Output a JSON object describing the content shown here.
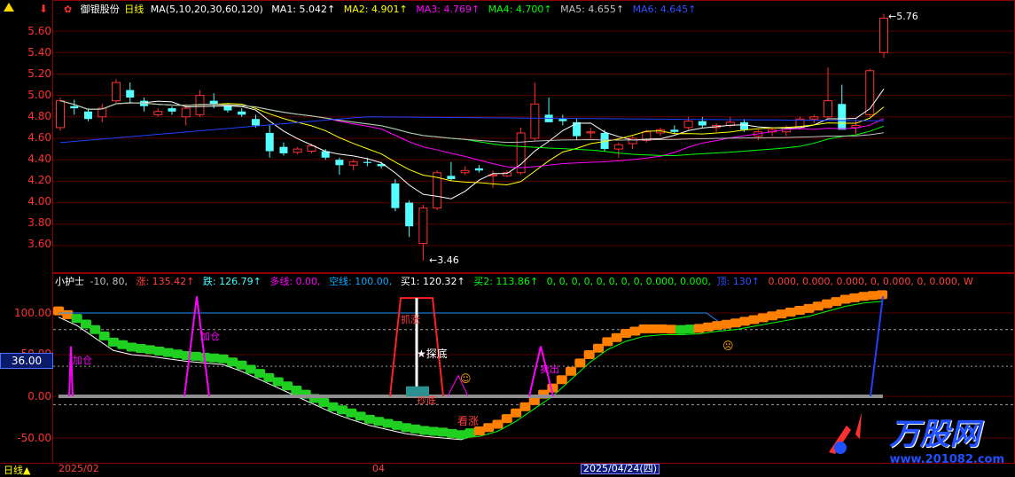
{
  "stock": {
    "name": "御银股份",
    "period": "日线"
  },
  "ma_header": {
    "formula": "MA(5,10,20,30,60,120)",
    "items": [
      {
        "label": "MA1:",
        "value": "5.042↑",
        "color": "#ffffff"
      },
      {
        "label": "MA2:",
        "value": "4.901↑",
        "color": "#ffff00"
      },
      {
        "label": "MA3:",
        "value": "4.769↑",
        "color": "#ff00ff"
      },
      {
        "label": "MA4:",
        "value": "4.700↑",
        "color": "#00ff00"
      },
      {
        "label": "MA5:",
        "value": "4.655↑",
        "color": "#c0c0c0"
      },
      {
        "label": "MA6:",
        "value": "4.645↑",
        "color": "#3050ff"
      }
    ]
  },
  "price_axis": [
    "5.60",
    "5.40",
    "5.20",
    "5.00",
    "4.80",
    "4.60",
    "4.40",
    "4.20",
    "4.00",
    "3.80",
    "3.60"
  ],
  "price_annotations": {
    "high": "5.76",
    "low": "3.46"
  },
  "indicator_header": {
    "name": "小护士",
    "params": "-10, 80,",
    "items": [
      {
        "label": "涨:",
        "value": "135.42↑",
        "color": "#ff4040"
      },
      {
        "label": "跌:",
        "value": "126.79↑",
        "color": "#40ffff"
      },
      {
        "label": "多线:",
        "value": "0.00,",
        "color": "#ff00ff"
      },
      {
        "label": "空线:",
        "value": "100.00,",
        "color": "#00aaff"
      },
      {
        "label": "买1:",
        "value": "120.32↑",
        "color": "#ffffff"
      },
      {
        "label": "买2:",
        "value": "113.86↑",
        "color": "#00ff00"
      },
      {
        "label": "",
        "value": "0, 0, 0, 0, 0, 0, 0, 0, 0.000, 0.000,",
        "color": "#ff4040"
      },
      {
        "label": "顶:",
        "value": "130↑",
        "color": "#3050ff"
      },
      {
        "label": "",
        "value": "0.000, 0.000, 0.000, 0, 0.000, 0, 0.000, W",
        "color": "#ff4040"
      }
    ]
  },
  "indicator_axis": [
    "100.00",
    "50.00",
    "0.00",
    "-50.00"
  ],
  "highlight_value": "36.00",
  "indicator_labels": {
    "jiacang1": "加仓",
    "jiacang2": "加仓",
    "zhuaniu": "抓涨",
    "tandi": "探底",
    "chaodi": "抄底",
    "kanzhang": "看涨",
    "maichu": "卖出"
  },
  "bottom": {
    "period_label": "日线▲",
    "date1": "2025/02",
    "date2": "04",
    "date_highlight": "2025/04/24(四)"
  },
  "watermark": {
    "brand": "万股网",
    "url": "www.201082.com"
  },
  "chart_data": [
    {
      "type": "candlestick",
      "title": "御银股份 日线",
      "ylim": [
        3.5,
        5.8
      ],
      "note": "approximate daily OHLC read from chart",
      "series": [
        {
          "name": "K",
          "values": [
            [
              4.7,
              4.98,
              4.67,
              4.95
            ],
            [
              4.9,
              4.96,
              4.82,
              4.88
            ],
            [
              4.85,
              4.88,
              4.76,
              4.78
            ],
            [
              4.8,
              4.92,
              4.75,
              4.88
            ],
            [
              4.95,
              5.15,
              4.93,
              5.12
            ],
            [
              5.05,
              5.12,
              4.93,
              4.98
            ],
            [
              4.95,
              4.98,
              4.85,
              4.9
            ],
            [
              4.82,
              4.88,
              4.8,
              4.85
            ],
            [
              4.88,
              4.9,
              4.82,
              4.85
            ],
            [
              4.8,
              4.92,
              4.72,
              4.88
            ],
            [
              4.82,
              5.05,
              4.8,
              5.0
            ],
            [
              4.95,
              5.02,
              4.88,
              4.92
            ],
            [
              4.9,
              4.92,
              4.84,
              4.86
            ],
            [
              4.85,
              4.88,
              4.8,
              4.82
            ],
            [
              4.78,
              4.82,
              4.7,
              4.72
            ],
            [
              4.65,
              4.72,
              4.42,
              4.48
            ],
            [
              4.52,
              4.56,
              4.44,
              4.46
            ],
            [
              4.47,
              4.52,
              4.45,
              4.5
            ],
            [
              4.48,
              4.55,
              4.46,
              4.53
            ],
            [
              4.48,
              4.5,
              4.4,
              4.42
            ],
            [
              4.4,
              4.42,
              4.26,
              4.35
            ],
            [
              4.35,
              4.4,
              4.3,
              4.38
            ],
            [
              4.38,
              4.42,
              4.34,
              4.37
            ],
            [
              4.36,
              4.38,
              4.32,
              4.34
            ],
            [
              4.18,
              4.22,
              3.92,
              3.95
            ],
            [
              4.0,
              4.02,
              3.68,
              3.78
            ],
            [
              3.62,
              3.98,
              3.46,
              3.95
            ],
            [
              3.95,
              4.3,
              3.93,
              4.28
            ],
            [
              4.25,
              4.38,
              4.2,
              4.22
            ],
            [
              4.28,
              4.34,
              4.26,
              4.3
            ],
            [
              4.32,
              4.35,
              4.28,
              4.3
            ],
            [
              4.25,
              4.3,
              4.14,
              4.26
            ],
            [
              4.25,
              4.3,
              4.24,
              4.28
            ],
            [
              4.28,
              4.7,
              4.26,
              4.65
            ],
            [
              4.6,
              5.12,
              4.58,
              4.92
            ],
            [
              4.82,
              4.98,
              4.76,
              4.75
            ],
            [
              4.78,
              4.82,
              4.72,
              4.76
            ],
            [
              4.75,
              4.78,
              4.58,
              4.62
            ],
            [
              4.65,
              4.7,
              4.6,
              4.66
            ],
            [
              4.65,
              4.68,
              4.48,
              4.5
            ],
            [
              4.5,
              4.56,
              4.42,
              4.54
            ],
            [
              4.55,
              4.62,
              4.5,
              4.6
            ],
            [
              4.58,
              4.68,
              4.56,
              4.66
            ],
            [
              4.65,
              4.7,
              4.62,
              4.68
            ],
            [
              4.68,
              4.72,
              4.64,
              4.66
            ],
            [
              4.7,
              4.8,
              4.68,
              4.76
            ],
            [
              4.76,
              4.8,
              4.7,
              4.72
            ],
            [
              4.7,
              4.74,
              4.66,
              4.72
            ],
            [
              4.72,
              4.8,
              4.7,
              4.75
            ],
            [
              4.75,
              4.78,
              4.66,
              4.68
            ],
            [
              4.62,
              4.68,
              4.58,
              4.66
            ],
            [
              4.66,
              4.7,
              4.62,
              4.68
            ],
            [
              4.66,
              4.72,
              4.62,
              4.7
            ],
            [
              4.7,
              4.8,
              4.68,
              4.78
            ],
            [
              4.78,
              4.82,
              4.74,
              4.8
            ],
            [
              4.8,
              5.26,
              4.78,
              4.95
            ],
            [
              4.92,
              5.1,
              4.7,
              4.68
            ],
            [
              4.7,
              4.78,
              4.64,
              4.72
            ],
            [
              4.82,
              5.25,
              4.8,
              5.23
            ],
            [
              5.4,
              5.76,
              5.35,
              5.72
            ]
          ]
        }
      ]
    },
    {
      "type": "line",
      "title": "小护士",
      "ylim": [
        -60,
        150
      ],
      "series": [
        {
          "name": "买1",
          "values": [
            95,
            85,
            70,
            55,
            50,
            48,
            45,
            42,
            40,
            38,
            30,
            20,
            10,
            0,
            -10,
            -20,
            -28,
            -35,
            -40,
            -45,
            -48,
            -50,
            -52,
            -45,
            -35,
            -20,
            -5,
            10,
            30,
            50,
            65,
            75,
            80,
            78,
            76,
            78,
            82,
            86,
            90,
            95,
            100,
            105,
            110,
            115,
            118,
            120
          ]
        },
        {
          "name": "买2",
          "values": [
            100,
            92,
            80,
            65,
            58,
            54,
            50,
            46,
            44,
            42,
            35,
            25,
            15,
            5,
            -5,
            -15,
            -22,
            -30,
            -35,
            -40,
            -44,
            -46,
            -50,
            -48,
            -42,
            -30,
            -15,
            0,
            20,
            40,
            56,
            66,
            72,
            74,
            74,
            75,
            78,
            80,
            84,
            88,
            92,
            96,
            102,
            108,
            112,
            114
          ]
        }
      ]
    }
  ]
}
